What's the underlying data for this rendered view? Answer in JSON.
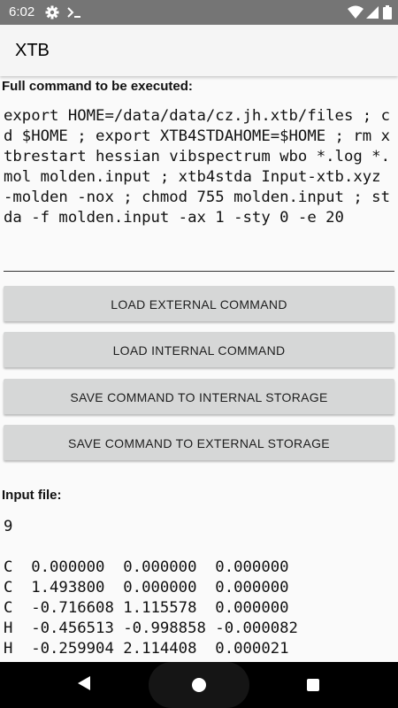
{
  "status_bar": {
    "time": "6:02",
    "icons": [
      "settings-gear-icon",
      "terminal-prompt-icon",
      "wifi-icon",
      "signal-icon",
      "battery-icon"
    ]
  },
  "app_bar": {
    "title": "XTB"
  },
  "command_section": {
    "label": "Full command to be executed:",
    "command": "export HOME=/data/data/cz.jh.xtb/files ; cd $HOME ; export XTB4STDAHOME=$HOME ; rm xtbrestart hessian vibspectrum wbo *.log *.mol molden.input ; xtb4stda Input-xtb.xyz -molden -nox ; chmod 755 molden.input ; stda -f molden.input -ax 1 -sty 0 -e 20"
  },
  "buttons": {
    "load_external": "LOAD EXTERNAL COMMAND",
    "load_internal": "LOAD INTERNAL COMMAND",
    "save_internal": "SAVE COMMAND TO INTERNAL STORAGE",
    "save_external": "SAVE COMMAND TO EXTERNAL STORAGE"
  },
  "input_section": {
    "label": "Input file:",
    "content": "9\n\nC  0.000000  0.000000  0.000000\nC  1.493800  0.000000  0.000000\nC  -0.716608 1.115578  0.000000\nH  -0.456513 -0.998858 -0.000082\nH  -0.259904 2.114408  0.000021"
  },
  "nav_bar": {
    "icons": [
      "back-icon",
      "home-icon",
      "recents-icon"
    ]
  }
}
